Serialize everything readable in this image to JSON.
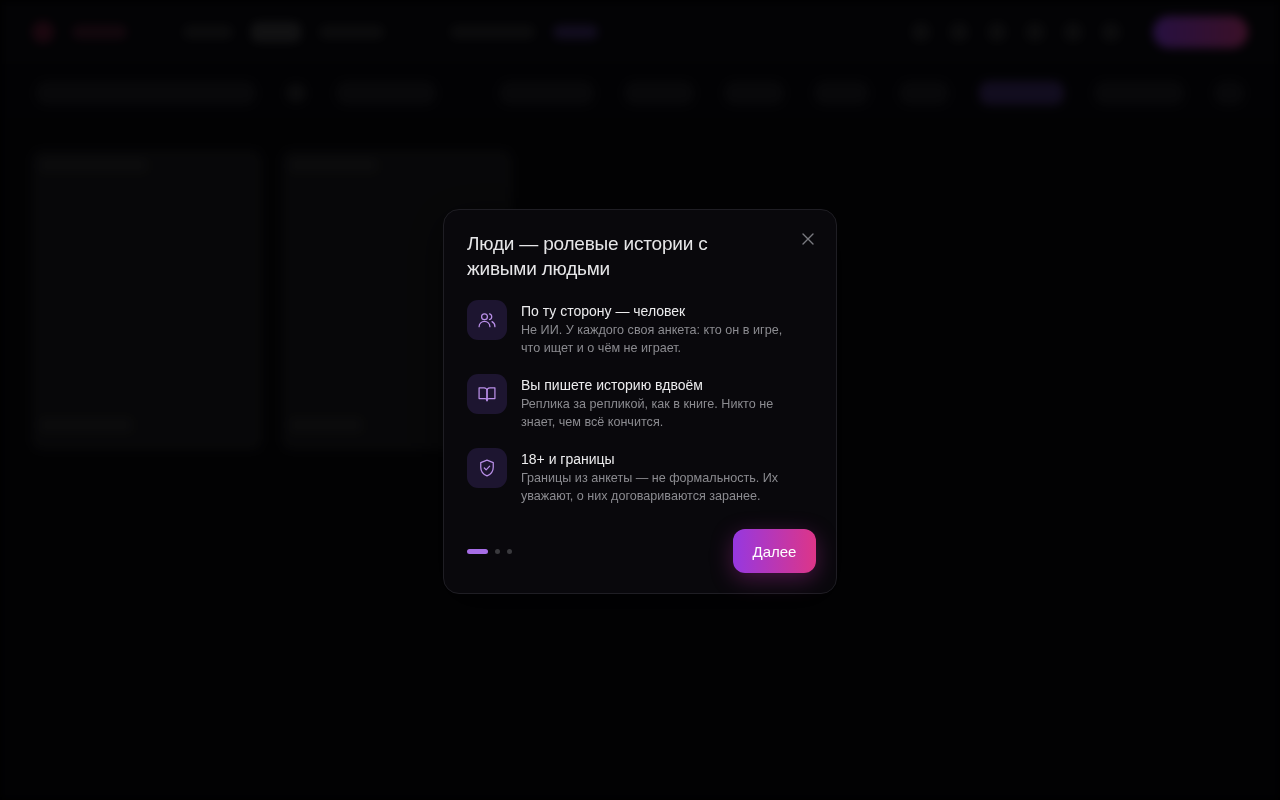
{
  "dialog": {
    "title": "Люди — ролевые истории с живыми людьми",
    "features": [
      {
        "title": "По ту сторону — человек",
        "text": "Не ИИ. У каждого своя анкета: кто он в игре, что ищет и о чём не играет."
      },
      {
        "title": "Вы пишете историю вдвоём",
        "text": "Реплика за репликой, как в книге. Никто не знает, чем всё кончится."
      },
      {
        "title": "18+ и границы",
        "text": "Границы из анкеты — не формальность. Их уважают, о них договариваются заранее."
      }
    ],
    "pager": [
      {
        "selected": true
      },
      {
        "selected": false
      },
      {
        "selected": false
      }
    ],
    "next_button": "Далее"
  }
}
